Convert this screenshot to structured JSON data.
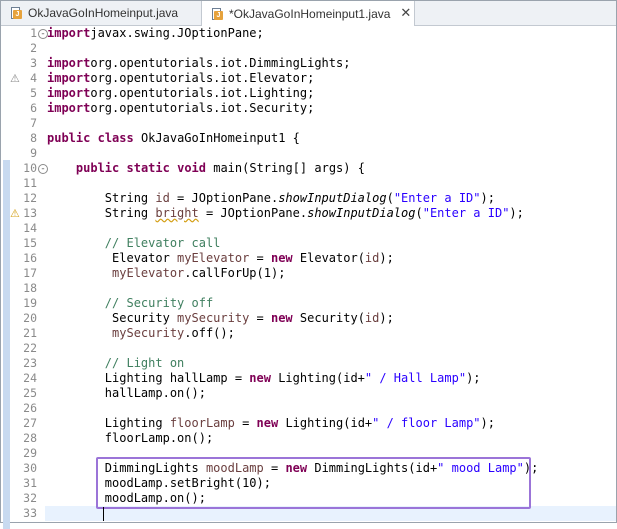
{
  "tabs": [
    {
      "label": "OkJavaGoInHomeinput.java",
      "active": false
    },
    {
      "label": "*OkJavaGoInHomeinput1.java",
      "active": true,
      "close": "✕"
    }
  ],
  "colors": {
    "keyword": "#7f0055",
    "string": "#2a00ff",
    "comment": "#3f7f5f",
    "local_variable": "#6a3e3e",
    "highlight_box": "#9b74d8",
    "current_line": "#e8f2fe"
  },
  "gutter_icons": {
    "line_4": "warning-icon",
    "line_13": "lightbulb-warning-icon"
  },
  "lines": [
    {
      "n": "1",
      "fold": "⊖",
      "tokens": [
        [
          "kw",
          "import"
        ],
        [
          "",
          "javax.swing.JOptionPane;"
        ]
      ]
    },
    {
      "n": "2",
      "tokens": []
    },
    {
      "n": "3",
      "tokens": [
        [
          "kw",
          "import"
        ],
        [
          "",
          "org.opentutorials.iot.DimmingLights;"
        ]
      ]
    },
    {
      "n": "4",
      "tokens": [
        [
          "kw",
          "import"
        ],
        [
          "",
          "org.opentutorials.iot.Elevator;"
        ]
      ]
    },
    {
      "n": "5",
      "tokens": [
        [
          "kw",
          "import"
        ],
        [
          "",
          "org.opentutorials.iot.Lighting;"
        ]
      ]
    },
    {
      "n": "6",
      "tokens": [
        [
          "kw",
          "import"
        ],
        [
          "",
          "org.opentutorials.iot.Security;"
        ]
      ]
    },
    {
      "n": "7",
      "tokens": []
    },
    {
      "n": "8",
      "tokens": [
        [
          "kw",
          "public"
        ],
        [
          "",
          " "
        ],
        [
          "kw",
          "class"
        ],
        [
          "",
          " OkJavaGoInHomeinput1 {"
        ]
      ]
    },
    {
      "n": "9",
      "tokens": []
    },
    {
      "n": "10",
      "fold": "⊖",
      "tokens": [
        [
          "",
          "    "
        ],
        [
          "kw",
          "public"
        ],
        [
          "",
          " "
        ],
        [
          "kw",
          "static"
        ],
        [
          "",
          " "
        ],
        [
          "kw",
          "void"
        ],
        [
          "",
          " main(String[] args) {"
        ]
      ]
    },
    {
      "n": "11",
      "tokens": []
    },
    {
      "n": "12",
      "tokens": [
        [
          "",
          "        String "
        ],
        [
          "fld",
          "id"
        ],
        [
          "",
          " = JOptionPane."
        ],
        [
          "it",
          "showInputDialog"
        ],
        [
          "",
          "("
        ],
        [
          "str",
          "\"Enter a ID\""
        ],
        [
          "",
          ");"
        ]
      ]
    },
    {
      "n": "13",
      "tokens": [
        [
          "",
          "        String "
        ],
        [
          "fldw",
          "bright"
        ],
        [
          "",
          " = JOptionPane."
        ],
        [
          "it",
          "showInputDialog"
        ],
        [
          "",
          "("
        ],
        [
          "str",
          "\"Enter a ID\""
        ],
        [
          "",
          ");"
        ]
      ]
    },
    {
      "n": "14",
      "tokens": []
    },
    {
      "n": "15",
      "tokens": [
        [
          "",
          "        "
        ],
        [
          "cm",
          "// Elevator call"
        ]
      ]
    },
    {
      "n": "16",
      "tokens": [
        [
          "",
          "         Elevator "
        ],
        [
          "fld",
          "myElevator"
        ],
        [
          "",
          " = "
        ],
        [
          "kw",
          "new"
        ],
        [
          "",
          " Elevator("
        ],
        [
          "fld",
          "id"
        ],
        [
          "",
          ");"
        ]
      ]
    },
    {
      "n": "17",
      "tokens": [
        [
          "",
          "         "
        ],
        [
          "fld",
          "myElevator"
        ],
        [
          "",
          ".callForUp(1);"
        ]
      ]
    },
    {
      "n": "18",
      "tokens": []
    },
    {
      "n": "19",
      "tokens": [
        [
          "",
          "        "
        ],
        [
          "cm",
          "// Security off"
        ]
      ]
    },
    {
      "n": "20",
      "tokens": [
        [
          "",
          "         Security "
        ],
        [
          "fld",
          "mySecurity"
        ],
        [
          "",
          " = "
        ],
        [
          "kw",
          "new"
        ],
        [
          "",
          " Security("
        ],
        [
          "fld",
          "id"
        ],
        [
          "",
          ");"
        ]
      ]
    },
    {
      "n": "21",
      "tokens": [
        [
          "",
          "         "
        ],
        [
          "fld",
          "mySecurity"
        ],
        [
          "",
          ".off();"
        ]
      ]
    },
    {
      "n": "22",
      "tokens": []
    },
    {
      "n": "23",
      "tokens": [
        [
          "",
          "        "
        ],
        [
          "cm",
          "// Light on"
        ]
      ]
    },
    {
      "n": "24",
      "tokens": [
        [
          "",
          "        Lighting hallLamp = "
        ],
        [
          "kw",
          "new"
        ],
        [
          "",
          " Lighting(id+"
        ],
        [
          "str",
          "\" / Hall Lamp\""
        ],
        [
          "",
          ");"
        ]
      ]
    },
    {
      "n": "25",
      "tokens": [
        [
          "",
          "        hallLamp.on();"
        ]
      ]
    },
    {
      "n": "26",
      "tokens": []
    },
    {
      "n": "27",
      "tokens": [
        [
          "",
          "        Lighting "
        ],
        [
          "fld",
          "floorLamp"
        ],
        [
          "",
          " = "
        ],
        [
          "kw",
          "new"
        ],
        [
          "",
          " Lighting(id+"
        ],
        [
          "str",
          "\" / floor Lamp\""
        ],
        [
          "",
          ");"
        ]
      ]
    },
    {
      "n": "28",
      "tokens": [
        [
          "",
          "        floorLamp.on();"
        ]
      ]
    },
    {
      "n": "29",
      "tokens": []
    },
    {
      "n": "30",
      "tokens": [
        [
          "",
          "        DimmingLights "
        ],
        [
          "fld",
          "moodLamp"
        ],
        [
          "",
          " = "
        ],
        [
          "kw",
          "new"
        ],
        [
          "",
          " DimmingLights(id+"
        ],
        [
          "str",
          "\" mood Lamp\""
        ],
        [
          "",
          ");"
        ]
      ]
    },
    {
      "n": "31",
      "tokens": [
        [
          "",
          "        moodLamp.setBright(10);"
        ]
      ]
    },
    {
      "n": "32",
      "tokens": [
        [
          "",
          "        moodLamp.on();"
        ]
      ]
    },
    {
      "n": "33",
      "tokens": []
    }
  ]
}
